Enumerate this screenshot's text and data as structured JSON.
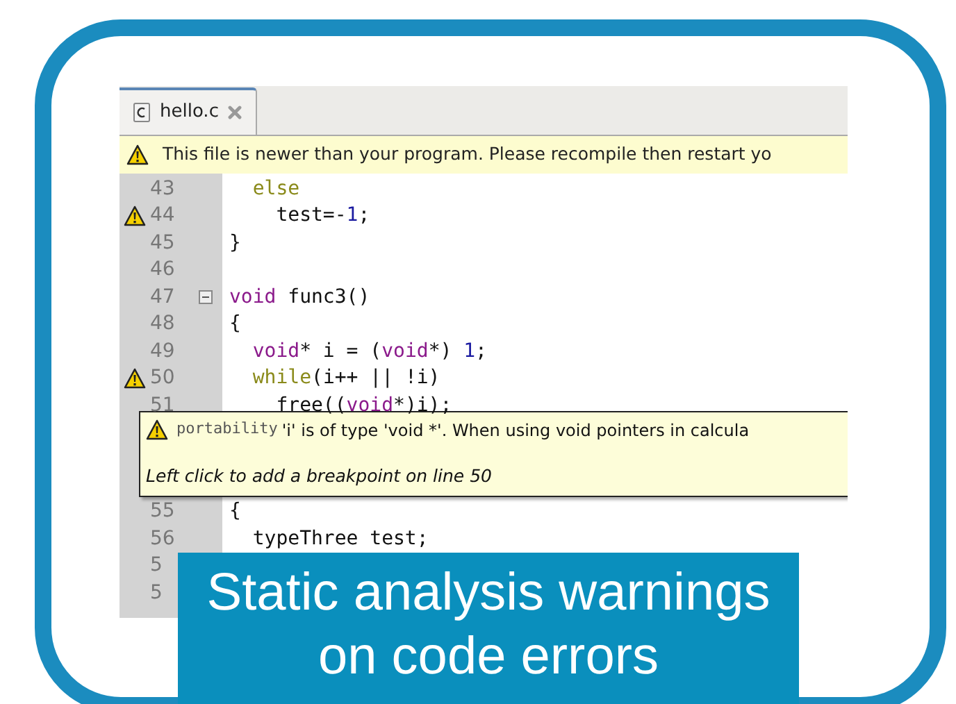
{
  "editor_tab": {
    "label": "hello.c",
    "selected": true
  },
  "notification": {
    "text": "This file is newer than your program. Please recompile then restart yo"
  },
  "lines": [
    {
      "number": "43",
      "warning": false,
      "fold": false,
      "tokens": [
        {
          "text": "  else",
          "kind": "control"
        }
      ]
    },
    {
      "number": "44",
      "warning": true,
      "fold": false,
      "tokens": [
        {
          "text": "    test=-",
          "kind": "plain"
        },
        {
          "text": "1",
          "kind": "number"
        },
        {
          "text": ";",
          "kind": "plain"
        }
      ]
    },
    {
      "number": "45",
      "warning": false,
      "fold": false,
      "tokens": [
        {
          "text": "}",
          "kind": "plain"
        }
      ]
    },
    {
      "number": "46",
      "warning": false,
      "fold": false
    },
    {
      "number": "47",
      "warning": false,
      "fold": true,
      "tokens": [
        {
          "text": "void",
          "kind": "keyword"
        },
        {
          "text": " func3()",
          "kind": "plain"
        }
      ]
    },
    {
      "number": "48",
      "warning": false,
      "fold": false,
      "tokens": [
        {
          "text": "{",
          "kind": "plain"
        }
      ]
    },
    {
      "number": "49",
      "warning": false,
      "fold": false,
      "tokens": [
        {
          "text": "  void",
          "kind": "keyword"
        },
        {
          "text": "* i = (",
          "kind": "plain"
        },
        {
          "text": "void",
          "kind": "keyword"
        },
        {
          "text": "*) ",
          "kind": "plain"
        },
        {
          "text": "1",
          "kind": "number"
        },
        {
          "text": ";",
          "kind": "plain"
        }
      ]
    },
    {
      "number": "50",
      "warning": true,
      "fold": false,
      "tokens": [
        {
          "text": "  while",
          "kind": "control"
        },
        {
          "text": "(i++ || !i)",
          "kind": "plain"
        }
      ]
    },
    {
      "number": "51",
      "warning": false,
      "fold": false,
      "tokens": [
        {
          "text": "    free((",
          "kind": "plain"
        },
        {
          "text": "void",
          "kind": "keyword"
        },
        {
          "text": "*)i);",
          "kind": "plain"
        }
      ]
    }
  ],
  "tooltip": {
    "category": "portability",
    "message": "'i' is of type 'void *'. When using void pointers in calcula",
    "hint": "Left click to add a breakpoint on line 50"
  },
  "lines_after": [
    {
      "number": "55",
      "warning": false,
      "fold": false,
      "tokens": [
        {
          "text": "{",
          "kind": "plain"
        }
      ]
    },
    {
      "number": "56",
      "warning": false,
      "fold": false,
      "tokens": [
        {
          "text": "  typeThree test;",
          "kind": "plain"
        }
      ]
    },
    {
      "number": "5",
      "warning": false
    },
    {
      "number": "5",
      "warning": false
    }
  ],
  "caption": "Static analysis warnings on code errors"
}
